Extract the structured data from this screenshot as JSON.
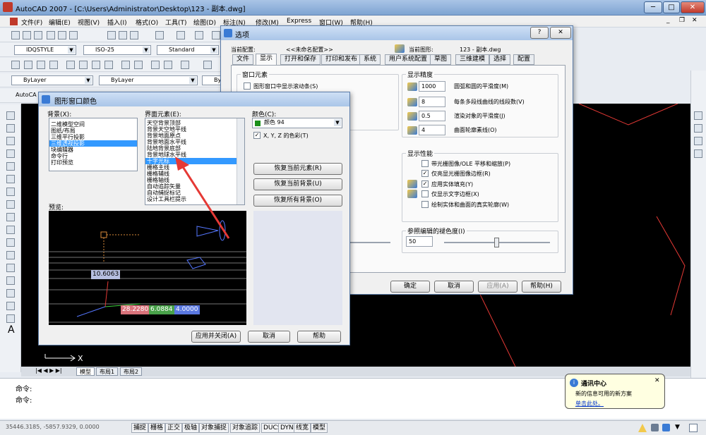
{
  "app": {
    "title": "AutoCAD 2007 - [C:\\Users\\Administrator\\Desktop\\123 - 副本.dwg]"
  },
  "menubar": {
    "items": [
      "文件(F)",
      "编辑(E)",
      "视图(V)",
      "插入(I)",
      "格式(O)",
      "工具(T)",
      "绘图(D)",
      "标注(N)",
      "修改(M)",
      "Express",
      "窗口(W)",
      "帮助(H)"
    ]
  },
  "toolbars": {
    "text_style": "IDQSTYLE",
    "dim_style": "ISO-25",
    "table_style": "Standard",
    "layer": "ByLayer",
    "linetype": "ByLayer",
    "lineweight": "By",
    "layer_prefix": "AutoCA"
  },
  "options_dialog": {
    "title": "选项",
    "help_btn": "?",
    "close_btn": "✕",
    "current_profile_label": "当前配置:",
    "current_profile_value": "<<未命名配置>>",
    "current_drawing_label": "当前图形:",
    "current_drawing_value": "123 - 副本.dwg",
    "tabs": [
      "文件",
      "显示",
      "打开和保存",
      "打印和发布",
      "系统",
      "用户系统配置",
      "草图",
      "三维建模",
      "选择",
      "配置"
    ],
    "window_elements": {
      "label": "窗口元素",
      "scrollbars": "图形窗口中显示滚动条(S)"
    },
    "display_resolution": {
      "label": "显示精度",
      "rows": [
        {
          "value": "1000",
          "label": "圆弧和圆的平滑度(M)"
        },
        {
          "value": "8",
          "label": "每条多段线曲线的线段数(V)"
        },
        {
          "value": "0.5",
          "label": "渲染对象的平滑度(J)"
        },
        {
          "value": "4",
          "label": "曲面轮廓素线(O)"
        }
      ]
    },
    "display_performance": {
      "label": "显示性能",
      "rows": [
        {
          "checked": false,
          "label": "带光栅图像/OLE 平移和缩放(P)"
        },
        {
          "checked": true,
          "label": "仅亮显光栅图像边框(R)"
        },
        {
          "checked": true,
          "label": "应用实体填充(Y)"
        },
        {
          "checked": false,
          "label": "仅显示文字边框(X)"
        },
        {
          "checked": false,
          "label": "绘制实体和曲面的真实轮廓(W)"
        }
      ]
    },
    "xref_fade": {
      "label": "参照编辑的褪色度(I)",
      "value": "50",
      "slider_fraction": 0.5
    },
    "buttons": {
      "ok": "确定",
      "cancel": "取消",
      "apply": "应用(A)",
      "help": "帮助(H)"
    }
  },
  "color_dialog": {
    "title": "图形窗口颜色",
    "context_label": "背景(X):",
    "contexts": [
      "二维模型空间",
      "图纸/布局",
      "三维平行投影",
      "三维透视投影",
      "块编辑器",
      "命令行",
      "打印预览"
    ],
    "context_selected": 3,
    "element_label": "界面元素(E):",
    "elements": [
      "天空背景顶部",
      "背景天空地平线",
      "背景地面原点",
      "背景地面水平线",
      "陆地背景底部",
      "背景地球水平线",
      "十字光标",
      "栅格主线",
      "栅格辅线",
      "栅格轴线",
      "自动追踪矢量",
      "自动捕捉标记",
      "设计工具栏提示"
    ],
    "element_selected": 6,
    "color_label": "颜色(C):",
    "color_value": "颜色 94",
    "color_swatch": "#1a8f1a",
    "tint_label": "X, Y, Z 的色彩(T)",
    "tint_checked": true,
    "restore_element": "恢复当前元素(R)",
    "restore_context": "恢复当前背景(U)",
    "restore_all": "恢复所有背景(O)",
    "preview_label": "预览:",
    "preview_coords": [
      "10.6063",
      "28.2280",
      "6.0884",
      "4.0000"
    ],
    "buttons": {
      "apply_close": "应用并关闭(A)",
      "cancel": "取消",
      "help": "帮助"
    }
  },
  "layout_tabs": [
    "模型",
    "布局1",
    "布局2"
  ],
  "command": {
    "lines": [
      "命令:",
      "命令:"
    ]
  },
  "statusbar": {
    "coords": "35446.3185, -5857.9329, 0.0000",
    "toggles": [
      "捕捉",
      "栅格",
      "正交",
      "极轴",
      "对象捕捉",
      "对象追踪",
      "DUCS",
      "DYN",
      "线宽",
      "模型"
    ]
  },
  "notification": {
    "title": "通讯中心",
    "body": "新的信息可用的新方案",
    "link": "单击此处。"
  },
  "colors": {
    "accent": "#3399ff",
    "arrow": "#e53935",
    "drawing_bg": "#000000"
  }
}
